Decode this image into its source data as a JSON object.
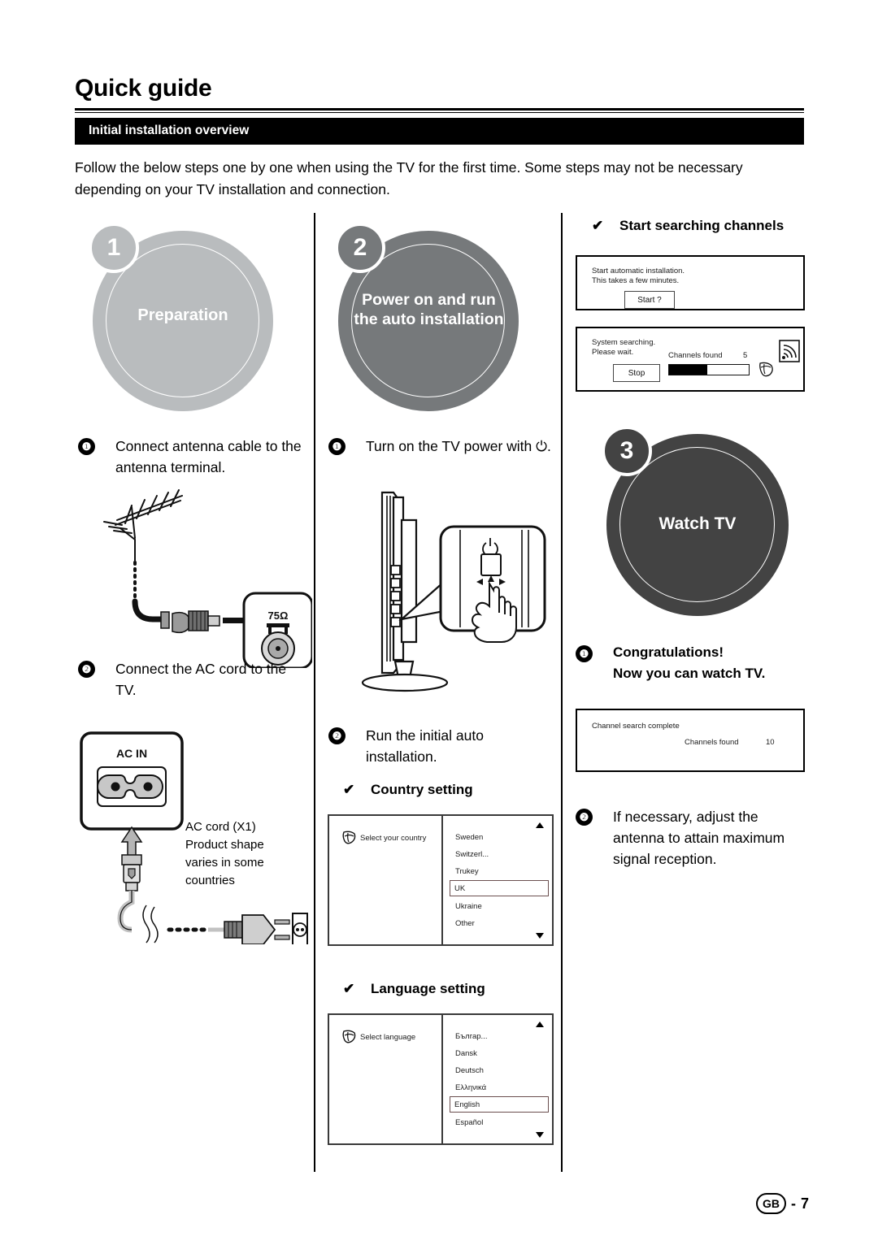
{
  "header": {
    "title": "Quick guide",
    "section_bar": "Initial installation overview",
    "intro": "Follow the below steps one by one when using the TV for the first time. Some steps may not be necessary depending on your TV installation and connection."
  },
  "colors": {
    "circle1": "#b9bcbe",
    "circle2": "#76797b",
    "circle3": "#434343",
    "bar_black": "#000000",
    "selection_border": "#6b4f4f"
  },
  "columns": [
    {
      "badge": "1",
      "circle_label": "Preparation",
      "steps": [
        {
          "num": "❶",
          "text": "Connect antenna cable to the antenna terminal."
        },
        {
          "num": "❷",
          "text": "Connect the AC cord to the TV."
        }
      ],
      "antenna_diagram": {
        "terminal_impedance": "75Ω"
      },
      "ac_diagram": {
        "jack_label": "AC IN",
        "caption": "AC cord (X1)\nProduct shape\nvaries in some\ncountries"
      }
    },
    {
      "badge": "2",
      "circle_label": "Power on and run\nthe auto installation",
      "steps": [
        {
          "num": "❶",
          "text": "Turn on the TV power with ⏻."
        },
        {
          "num": "❷",
          "text": "Run the initial auto installation."
        }
      ],
      "checks": [
        {
          "tick": "✔",
          "label": "Country setting",
          "left_label": "Select your country",
          "items": [
            "Sweden",
            "Switzerl...",
            "Trukey",
            "UK",
            "Ukraine",
            "Other"
          ],
          "selected": "UK"
        },
        {
          "tick": "✔",
          "label": "Language setting",
          "left_label": "Select language",
          "items": [
            "Българ...",
            "Dansk",
            "Deutsch",
            "Ελληνικά",
            "English",
            "Español"
          ],
          "selected": "English"
        }
      ]
    },
    {
      "badge": "3",
      "circle_label": "Watch TV",
      "check_top": {
        "tick": "✔",
        "label": "Start searching channels"
      },
      "osd_start": {
        "line1": "Start automatic installation.",
        "line2": "This takes a few minutes.",
        "button": "Start ?"
      },
      "osd_searching": {
        "line1": "System searching.",
        "line2": "Please wait.",
        "button": "Stop",
        "channels_found_label": "Channels found",
        "channels_found_value": "5",
        "progress_percent": 48
      },
      "steps": [
        {
          "num": "❶",
          "text": "Congratulations!\nNow you can watch TV."
        },
        {
          "num": "❷",
          "text": "If necessary, adjust the antenna to attain maximum signal reception."
        }
      ],
      "osd_complete": {
        "line1": "Channel search complete",
        "channels_found_label": "Channels found",
        "channels_found_value": "10"
      }
    }
  ],
  "footer": {
    "region": "GB",
    "separator": "-",
    "page": "7"
  }
}
